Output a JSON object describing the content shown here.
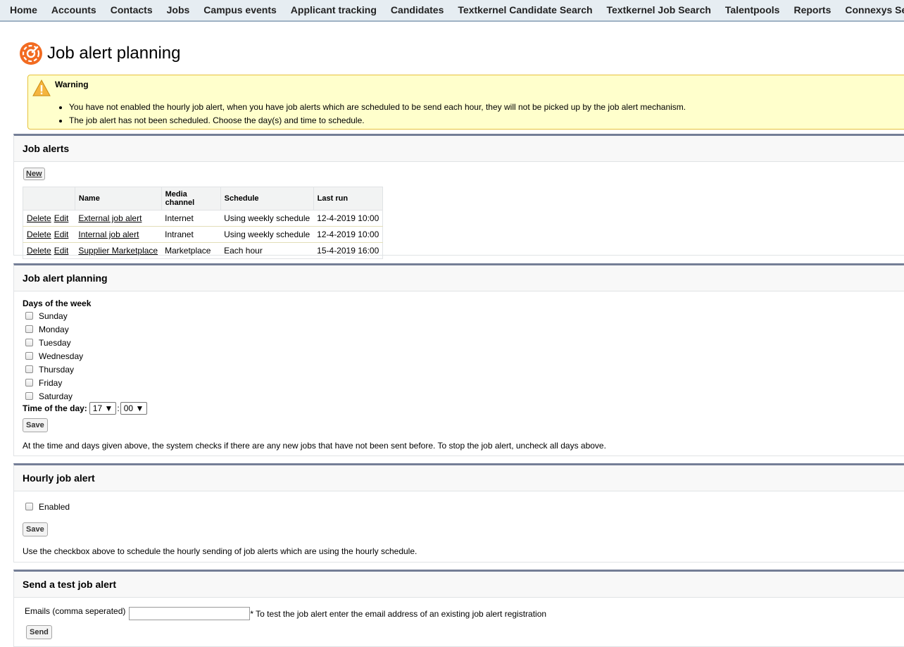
{
  "nav": {
    "items": [
      "Home",
      "Accounts",
      "Contacts",
      "Jobs",
      "Campus events",
      "Applicant tracking",
      "Candidates",
      "Textkernel Candidate Search",
      "Textkernel Job Search",
      "Talentpools",
      "Reports",
      "Connexys Setup"
    ],
    "plus": "+"
  },
  "page": {
    "title": "Job alert planning"
  },
  "warning": {
    "title": "Warning",
    "messages": [
      "You have not enabled the hourly job alert, when you have job alerts which are scheduled to be send each hour, they will not be picked up by the job alert mechanism.",
      "The job alert has not been scheduled. Choose the day(s) and time to schedule."
    ]
  },
  "job_alerts": {
    "title": "Job alerts",
    "new_label": "New",
    "columns": [
      "",
      "Name",
      "Media channel",
      "Schedule",
      "Last run"
    ],
    "delete_label": "Delete",
    "edit_label": "Edit",
    "rows": [
      {
        "name": "External job alert",
        "channel": "Internet",
        "schedule": "Using weekly schedule",
        "last_run": "12-4-2019 10:00"
      },
      {
        "name": "Internal job alert",
        "channel": "Intranet",
        "schedule": "Using weekly schedule",
        "last_run": "12-4-2019 10:00"
      },
      {
        "name": "Supplier Marketplace",
        "channel": "Marketplace",
        "schedule": "Each hour",
        "last_run": "15-4-2019 16:00"
      }
    ]
  },
  "planning": {
    "title": "Job alert planning",
    "days_label": "Days of the week",
    "days": [
      "Sunday",
      "Monday",
      "Tuesday",
      "Wednesday",
      "Thursday",
      "Friday",
      "Saturday"
    ],
    "time_label": "Time of the day:",
    "hour": "17",
    "minute": "00",
    "time_sep": ":",
    "save_label": "Save",
    "help": "At the time and days given above, the system checks if there are any new jobs that have not been sent before. To stop the job alert, uncheck all days above."
  },
  "hourly": {
    "title": "Hourly job alert",
    "enabled_label": "Enabled",
    "save_label": "Save",
    "help": "Use the checkbox above to schedule the hourly sending of job alerts which are using the hourly schedule."
  },
  "test": {
    "title": "Send a test job alert",
    "emails_label": "Emails (comma seperated)",
    "hint": "* To test the job alert enter the email address of an existing job alert registration",
    "send_label": "Send",
    "email_value": ""
  }
}
